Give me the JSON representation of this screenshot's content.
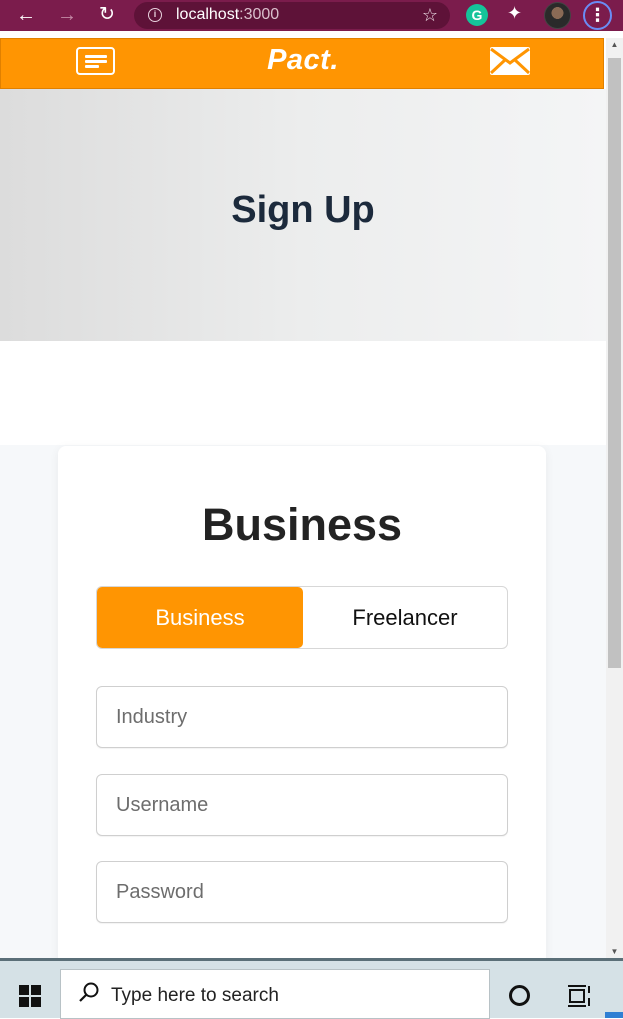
{
  "browser": {
    "url_host": "localhost",
    "url_port": ":3000",
    "ext_g_letter": "G"
  },
  "navbar": {
    "brand": "Pact."
  },
  "hero": {
    "title": "Sign Up"
  },
  "card": {
    "title": "Business",
    "toggle": {
      "options": [
        "Business",
        "Freelancer"
      ],
      "selected": "Business"
    },
    "fields": {
      "industry_placeholder": "Industry",
      "username_placeholder": "Username",
      "password_placeholder": "Password"
    }
  },
  "taskbar": {
    "search_placeholder": "Type here to search"
  },
  "colors": {
    "accent": "#ff9502",
    "browser_frame": "#7b1c4c",
    "hero_title": "#1c2a3c"
  }
}
